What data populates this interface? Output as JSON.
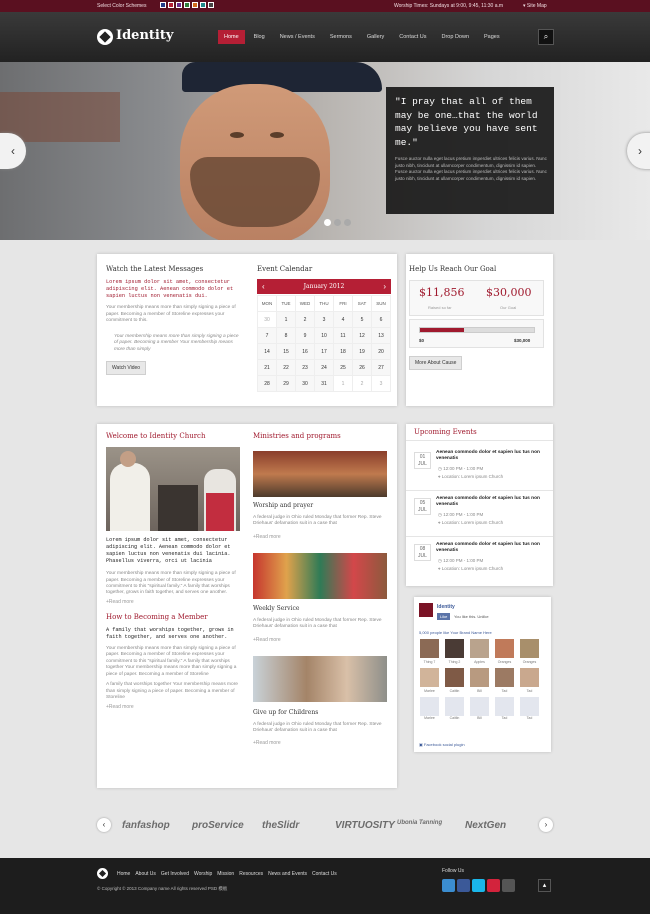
{
  "topbar": {
    "schemes_label": "Select Color Schemes",
    "schemes": [
      "#1f3e8a",
      "#b51f35",
      "#6b2d8e",
      "#2f7d3a",
      "#d16c1c",
      "#1d8a8a",
      "#444444"
    ],
    "worship": "Worship Times: Sundays at 9:00, 9:45, 11:30 a.m",
    "sitemap": "Site Map"
  },
  "header": {
    "logo": "Identity",
    "nav": [
      "Home",
      "Blog",
      "News / Events",
      "Sermons",
      "Gallery",
      "Contact Us",
      "Drop Down",
      "Pages"
    ]
  },
  "hero": {
    "quote": "\"I pray that all of them may be one…that the world may believe you have sent me.\"",
    "text": "Fusce auctor nulla eget lacus pretium imperdiet ultrices felicis varius. Nunc justo nibh, tincidunt at ullamcorper condimentum, dignissim id sapien. Fusce auctor nulla eget lacus pretium imperdiet ultrices felicis varius. Nunc justo nibh, tincidunt at ullamcorper condimentum, dignissim id sapien."
  },
  "messages": {
    "title": "Watch the Latest Messages",
    "lead": "Lorem ipsum dolor sit amet, consectetur adipiscing elit. Aenean commodo dolor et sapien luctus non venenatis dui.",
    "body": "Your membership means more than simply signing a piece of paper. Becoming a member of Storeline expresses your commitment to this.",
    "quote": "Your membership means more than simply signing a piece of paper. Becoming a member Your membership means more than simply",
    "button": "Watch Video"
  },
  "calendar": {
    "title": "Event Calendar",
    "month": "January 2012",
    "days": [
      "MON",
      "TUE",
      "WED",
      "THU",
      "FRI",
      "SAT",
      "SUN"
    ],
    "weeks": [
      [
        "30",
        "1",
        "2",
        "3",
        "4",
        "5",
        "6"
      ],
      [
        "7",
        "8",
        "9",
        "10",
        "11",
        "12",
        "13"
      ],
      [
        "14",
        "15",
        "16",
        "17",
        "18",
        "19",
        "20"
      ],
      [
        "21",
        "22",
        "23",
        "24",
        "25",
        "26",
        "27"
      ],
      [
        "28",
        "29",
        "30",
        "31",
        "1",
        "2",
        "3"
      ]
    ]
  },
  "goal": {
    "title": "Help Us Reach Our Goal",
    "raised": "$11,856",
    "raised_label": "Raised so far",
    "goal": "$30,000",
    "goal_label": "Our Goal",
    "progress": 0.39,
    "min": "$0",
    "max": "$30,000",
    "button": "More About Cause"
  },
  "welcome": {
    "title": "Welcome to Identity Church",
    "lead": "Lorem ipsum dolor sit amet, consectetur adipiscing elit. Aenean commodo dolor et sapien luctus non venenatis dui lacinia. Phasellus viverra, orci ut lacinia",
    "body": "Your membership means more than simply signing a piece of paper. Becoming a member of Storeline expresses your commitment to this \"spiritual family.\" A family that worships together, grows in faith together, and serves one another.",
    "read": "+Read more",
    "title2": "How to Becoming a Member",
    "lead2": "A family that worships together, grows in faith together, and serves one another.",
    "body2": "Your membership means more than simply signing a piece of paper. Becoming a member of Storeline expresses your commitment to this \"spiritual family.\" A family that worships together Your membership means more than simply signing a piece of paper. Becoming a member of Storeline",
    "body3": "A family that worships together Your membership means more than simply signing a piece of paper. Becoming a member of Storeline",
    "read2": "+Read more"
  },
  "ministries": {
    "title": "Ministries and programs",
    "items": [
      {
        "title": "Worship and prayer",
        "text": "A federal judge in Ohio ruled Monday that former Rep. Steve Driehaus' defamation suit in a case that",
        "read": "+Read more"
      },
      {
        "title": "Weekly Service",
        "text": "A federal judge in Ohio ruled Monday that former Rep. Steve Driehaus' defamation suit in a case that",
        "read": "+Read more"
      },
      {
        "title": "Give up for Childrens",
        "text": "A federal judge in Ohio ruled Monday that former Rep. Steve Driehaus' defamation suit in a case that",
        "read": "+Read more"
      }
    ]
  },
  "events": {
    "title": "Upcoming Events",
    "items": [
      {
        "day": "01",
        "mon": "JUL",
        "title": "Aenean commodo dolor et sapien luc tus non venenatis",
        "time": "12:00 PM - 1:00 PM",
        "loc": "Location: Lorem ipsum Church"
      },
      {
        "day": "05",
        "mon": "JUL",
        "title": "Aenean commodo dolor et sapien luc tus non venenatis",
        "time": "12:00 PM - 1:00 PM",
        "loc": "Location: Lorem ipsum Church"
      },
      {
        "day": "08",
        "mon": "JUL",
        "title": "Aenean commodo dolor et sapien luc tus non venenatis",
        "time": "12:00 PM - 1:00 PM",
        "loc": "Location: Lorem ipsum Church"
      }
    ]
  },
  "facebook": {
    "name": "Identity",
    "like": "Like",
    "likes_text": "You like this. Unlike",
    "count_text": "5,000 people like Your Brand Name Here",
    "row1": [
      "Thing 7",
      "Thing 2",
      "Apples",
      "Oranges",
      "Oranges"
    ],
    "row2": [
      "Marlee",
      "Caitlin",
      "Bill",
      "Tad",
      "Tad"
    ],
    "row3": [
      "Marlee",
      "Caitlin",
      "Bill",
      "Tad",
      "Tad"
    ],
    "plugin": "Facebook social plugin"
  },
  "partners": [
    "fanfashop",
    "proService",
    "theSlidr",
    "VIRTUOSITY",
    "Ubonia Tanning",
    "NextGen"
  ],
  "footer": {
    "links": [
      "Home",
      "About Us",
      "Get Involved",
      "Worship",
      "Mission",
      "Resources",
      "News and Events",
      "Contact Us"
    ],
    "copyright": "© Copyright © 2013 Company name All rights reserved PSD 模板",
    "follow": "Follow Us",
    "social": [
      "#3b8dd0",
      "#3b5998",
      "#1ab7ea",
      "#d3233c",
      "#555555"
    ]
  }
}
